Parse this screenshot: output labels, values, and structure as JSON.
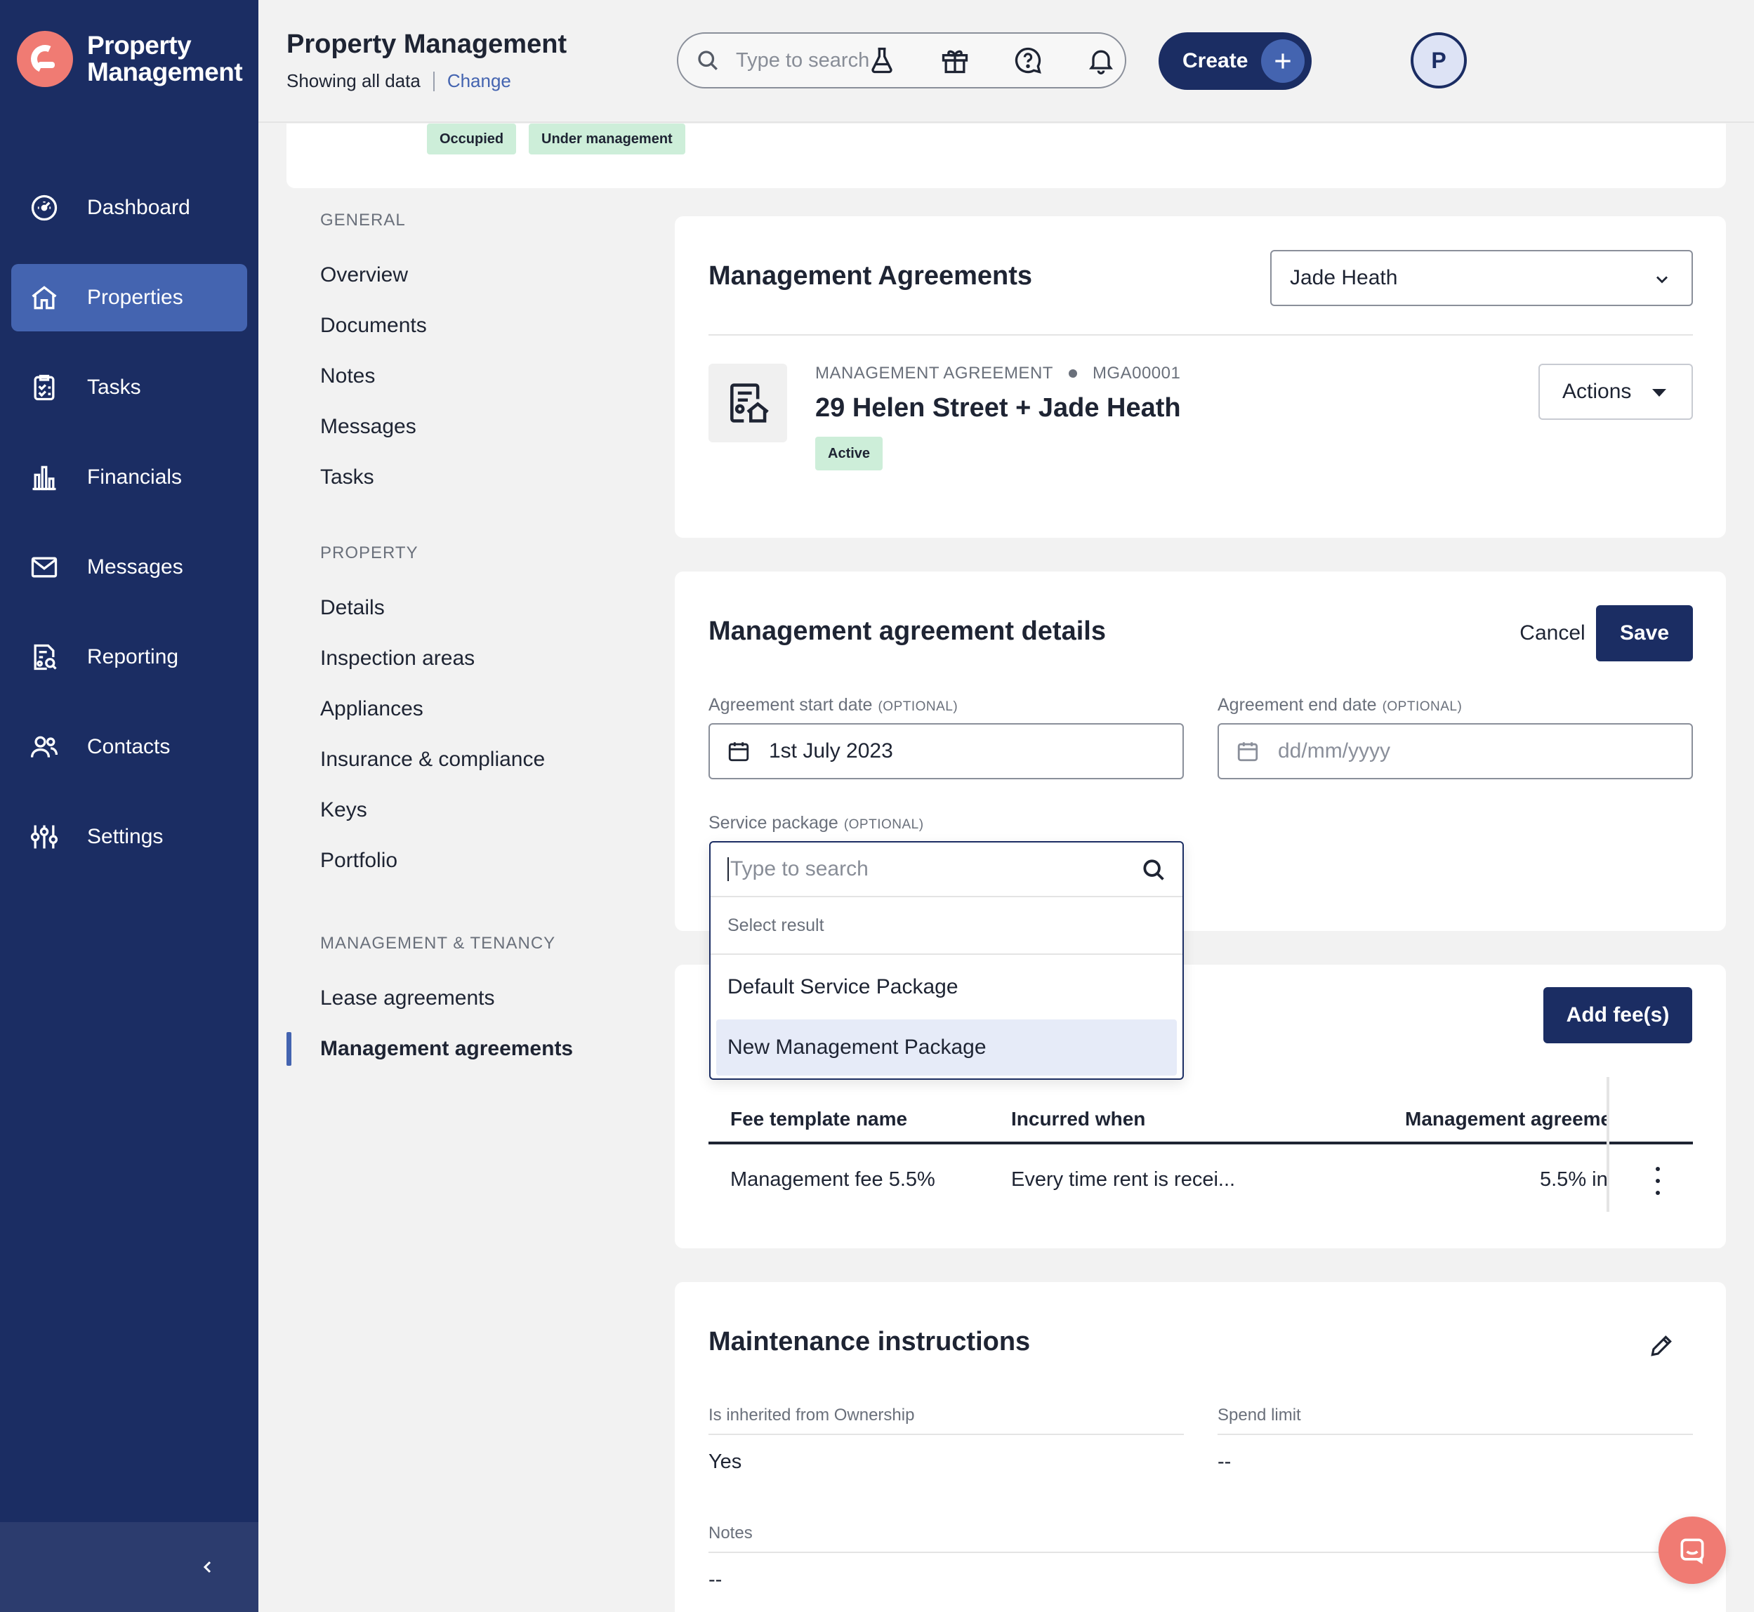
{
  "app": {
    "logo_line1": "Property",
    "logo_line2": "Management",
    "brand_color": "#1b2d63",
    "accent_color": "#f07b73"
  },
  "sidebar": {
    "items": [
      {
        "label": "Dashboard",
        "icon": "dashboard-icon"
      },
      {
        "label": "Properties",
        "icon": "home-icon",
        "active": true
      },
      {
        "label": "Tasks",
        "icon": "clipboard-icon"
      },
      {
        "label": "Financials",
        "icon": "bar-chart-icon"
      },
      {
        "label": "Messages",
        "icon": "envelope-icon"
      },
      {
        "label": "Reporting",
        "icon": "report-search-icon"
      },
      {
        "label": "Contacts",
        "icon": "contacts-icon"
      },
      {
        "label": "Settings",
        "icon": "sliders-icon"
      }
    ],
    "collapse_icon": "chevron-left-icon"
  },
  "header": {
    "title": "Property Management",
    "subtitle": "Showing all data",
    "change_link": "Change",
    "search_placeholder": "Type to search",
    "create_label": "Create",
    "avatar_initial": "P",
    "icons": [
      "flask-icon",
      "gift-icon",
      "help-icon",
      "bell-icon"
    ]
  },
  "property": {
    "tags": [
      "Occupied",
      "Under management"
    ]
  },
  "subnav": {
    "general_title": "GENERAL",
    "general": [
      "Overview",
      "Documents",
      "Notes",
      "Messages",
      "Tasks"
    ],
    "property_title": "PROPERTY",
    "property": [
      "Details",
      "Inspection areas",
      "Appliances",
      "Insurance & compliance",
      "Keys",
      "Portfolio"
    ],
    "mgmt_title": "MANAGEMENT & TENANCY",
    "mgmt": [
      "Lease agreements",
      "Management agreements"
    ]
  },
  "agreements": {
    "title": "Management Agreements",
    "owner_select": "Jade Heath",
    "type_label": "MANAGEMENT AGREEMENT",
    "code": "MGA00001",
    "name": "29 Helen Street + Jade Heath",
    "status": "Active",
    "actions_label": "Actions"
  },
  "details": {
    "title": "Management agreement details",
    "cancel_label": "Cancel",
    "save_label": "Save",
    "start_label": "Agreement start date",
    "end_label": "Agreement end date",
    "optional_tag": "(OPTIONAL)",
    "start_value": "1st July 2023",
    "end_placeholder": "dd/mm/yyyy",
    "service_label": "Service package"
  },
  "dropdown": {
    "search_placeholder": "Type to search",
    "header": "Select result",
    "options": [
      "Default Service Package",
      "New Management Package"
    ]
  },
  "fees": {
    "add_label": "Add fee(s)",
    "columns": [
      "Fee template name",
      "Incurred when",
      "Management agreeme"
    ],
    "rows": [
      {
        "name": "Management fee 5.5%",
        "when": "Every time rent is recei...",
        "value": "5.5% in"
      }
    ]
  },
  "maintenance": {
    "title": "Maintenance instructions",
    "inherited_label": "Is inherited from Ownership",
    "inherited_value": "Yes",
    "spend_label": "Spend limit",
    "spend_value": "--",
    "notes_label": "Notes",
    "notes_value": "--"
  }
}
